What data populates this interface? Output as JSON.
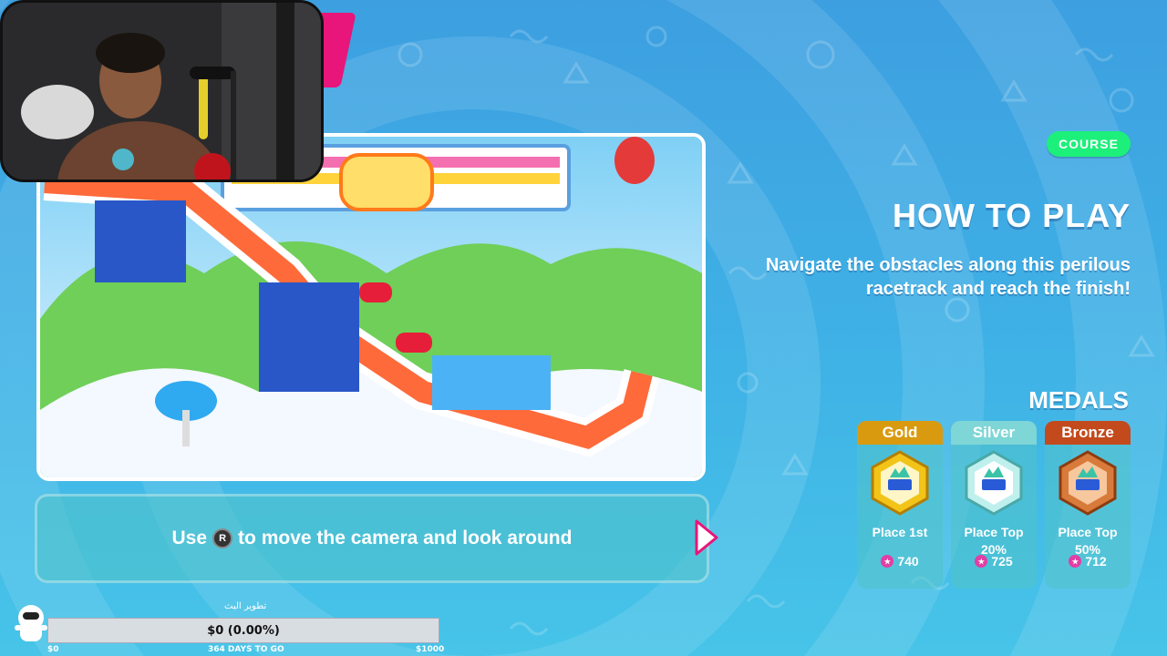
{
  "badge": "COURSE",
  "how_to_play": {
    "title": "HOW TO PLAY",
    "description": "Navigate the obstacles along this perilous racetrack and reach the finish!"
  },
  "tip": {
    "before": "Use",
    "button": "R",
    "after": "to move the camera and look around"
  },
  "medals": {
    "title": "MEDALS",
    "items": [
      {
        "name": "Gold",
        "condition_line1": "Place 1st",
        "condition_line2": "",
        "points": "740",
        "head_color": "#d99a10",
        "hex_color": "#f2c418"
      },
      {
        "name": "Silver",
        "condition_line1": "Place Top",
        "condition_line2": "20%",
        "points": "725",
        "head_color": "#7fd6d6",
        "hex_color": "#bff0ee"
      },
      {
        "name": "Bronze",
        "condition_line1": "Place Top",
        "condition_line2": "50%",
        "points": "712",
        "head_color": "#c24a1d",
        "hex_color": "#d87a3a"
      }
    ]
  },
  "goal": {
    "label": "تطوير البث",
    "amount": "$0 (0.00%)",
    "progress_fraction": 0.0,
    "min": "$0",
    "days": "364 DAYS TO GO",
    "max": "$1000"
  }
}
